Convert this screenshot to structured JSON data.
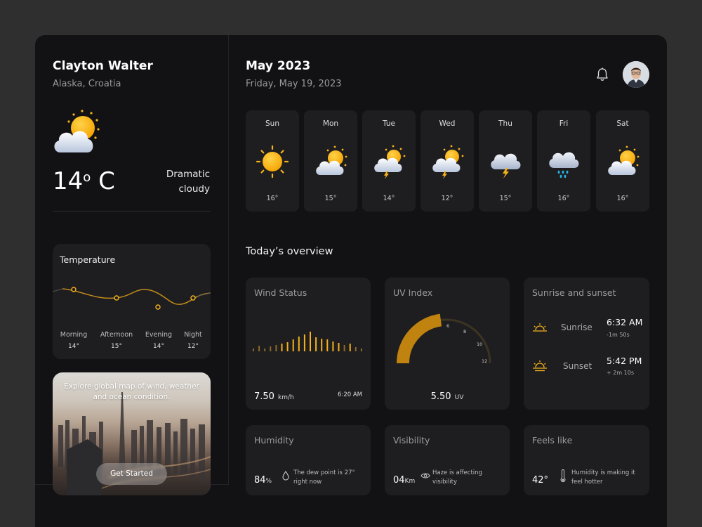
{
  "user": {
    "name": "Clayton Walter",
    "location": "Alaska, Croatia"
  },
  "current": {
    "temp": "14",
    "deg": "o",
    "unit": "C",
    "condition": "Dramatic cloudy",
    "icon": "sun-cloud-icon"
  },
  "temperature_card": {
    "title": "Temperature",
    "periods": [
      {
        "label": "Morning",
        "value": "14°"
      },
      {
        "label": "Afternoon",
        "value": "15°"
      },
      {
        "label": "Evening",
        "value": "14°"
      },
      {
        "label": "Night",
        "value": "12°"
      }
    ]
  },
  "promo": {
    "text": "Explore global map of wind, weather and ocean condition.",
    "button": "Get Started"
  },
  "header": {
    "month": "May 2023",
    "date": "Friday, May 19, 2023"
  },
  "week": [
    {
      "day": "Sun",
      "temp": "16°",
      "icon": "sun-icon"
    },
    {
      "day": "Mon",
      "temp": "15°",
      "icon": "sun-cloud-icon"
    },
    {
      "day": "Tue",
      "temp": "14°",
      "icon": "sun-cloud-storm-icon"
    },
    {
      "day": "Wed",
      "temp": "12°",
      "icon": "sun-cloud-storm-icon"
    },
    {
      "day": "Thu",
      "temp": "15°",
      "icon": "cloud-storm-icon"
    },
    {
      "day": "Fri",
      "temp": "16°",
      "icon": "cloud-rain-icon"
    },
    {
      "day": "Sat",
      "temp": "16°",
      "icon": "sun-cloud-icon"
    }
  ],
  "overview": {
    "title": "Today’s overview",
    "wind": {
      "title": "Wind Status",
      "value": "7.50",
      "unit": "km/h",
      "time": "6:20 AM"
    },
    "uv": {
      "title": "UV Index",
      "value": "5.50",
      "unit": "UV",
      "ticks": [
        "6",
        "8",
        "10",
        "12"
      ],
      "level": 5.5,
      "max": 12
    },
    "sun": {
      "title": "Sunrise and sunset",
      "sunrise": {
        "label": "Sunrise",
        "time": "6:32 AM",
        "delta": "-1m 50s"
      },
      "sunset": {
        "label": "Sunset",
        "time": "5:42 PM",
        "delta": "+ 2m 10s"
      }
    },
    "humidity": {
      "title": "Humidity",
      "value": "84",
      "unit": "%",
      "note": "The dew point is 27° right now"
    },
    "visibility": {
      "title": "Visibility",
      "value": "04",
      "unit": "Km",
      "note": "Haze is affecting visibility"
    },
    "feels": {
      "title": "Feels like",
      "value": "42°",
      "note": "Humidity is making it feel hotter"
    }
  },
  "colors": {
    "accent": "#f6b21b",
    "card": "#1e1e20",
    "panel": "#121214"
  }
}
